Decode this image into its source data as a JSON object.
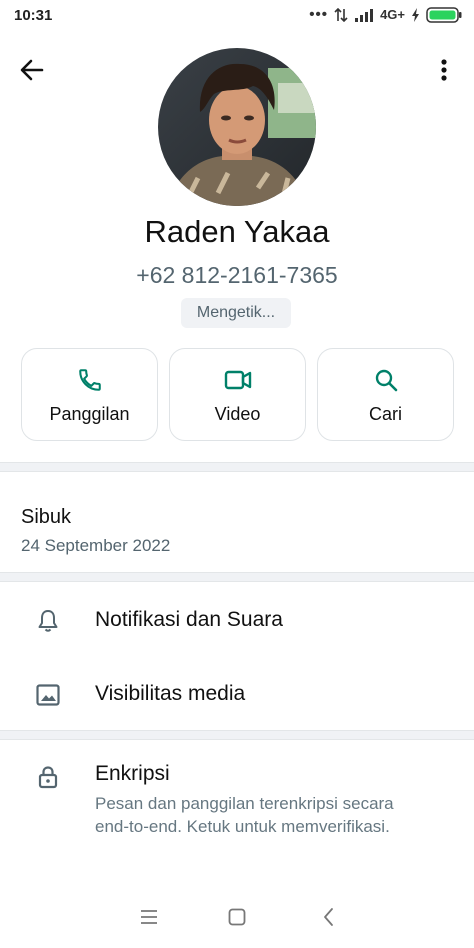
{
  "status_bar": {
    "time": "10:31",
    "network": "4G+",
    "battery_color": "#2bd35e"
  },
  "header": {
    "back_icon": "arrow-left-icon",
    "menu_icon": "more-vertical-icon"
  },
  "contact": {
    "name": "Raden Yakaa",
    "phone": "+62 812-2161-7365",
    "status": "Mengetik..."
  },
  "actions": [
    {
      "label": "Panggilan",
      "icon": "phone-icon"
    },
    {
      "label": "Video",
      "icon": "video-icon"
    },
    {
      "label": "Cari",
      "icon": "search-icon"
    }
  ],
  "about": {
    "text": "Sibuk",
    "date": "24 September 2022"
  },
  "settings": {
    "notifications": "Notifikasi dan Suara",
    "media_visibility": "Visibilitas media"
  },
  "encryption": {
    "title": "Enkripsi",
    "description": "Pesan dan panggilan terenkripsi secara end-to-end. Ketuk untuk memverifikasi."
  },
  "colors": {
    "accent": "#008069",
    "icon_grey": "#54656f"
  }
}
